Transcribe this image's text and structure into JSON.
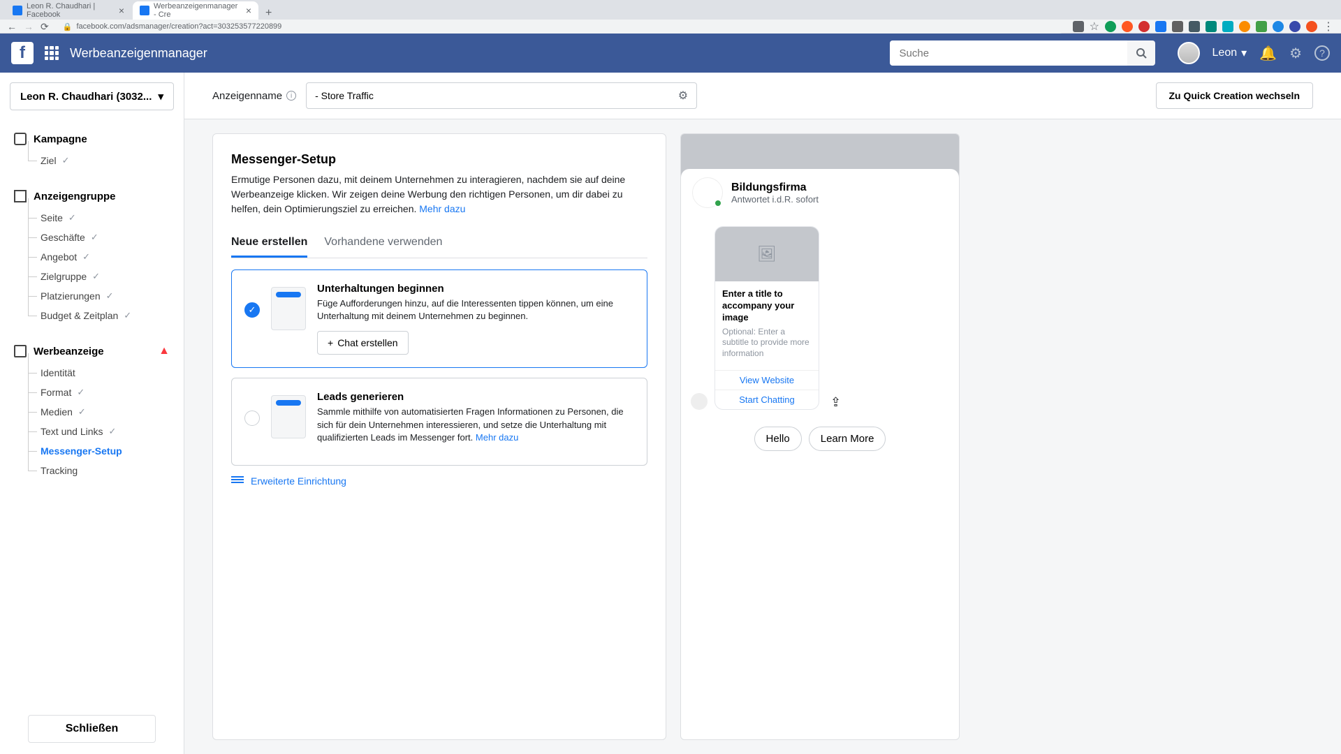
{
  "browser": {
    "tabs": [
      {
        "title": "Leon R. Chaudhari | Facebook"
      },
      {
        "title": "Werbeanzeigenmanager - Cre"
      }
    ],
    "url": "facebook.com/adsmanager/creation?act=303253577220899"
  },
  "header": {
    "app_title": "Werbeanzeigenmanager",
    "search_placeholder": "Suche",
    "user_name": "Leon"
  },
  "sidebar": {
    "account": "Leon R. Chaudhari (3032...",
    "campaign": {
      "label": "Kampagne",
      "items": [
        "Ziel"
      ]
    },
    "adset": {
      "label": "Anzeigengruppe",
      "items": [
        "Seite",
        "Geschäfte",
        "Angebot",
        "Zielgruppe",
        "Platzierungen",
        "Budget & Zeitplan"
      ]
    },
    "ad": {
      "label": "Werbeanzeige",
      "items": [
        "Identität",
        "Format",
        "Medien",
        "Text und Links",
        "Messenger-Setup",
        "Tracking"
      ]
    },
    "close": "Schließen"
  },
  "topbar": {
    "name_label": "Anzeigenname",
    "name_value": "- Store Traffic",
    "quick_btn": "Zu Quick Creation wechseln"
  },
  "card": {
    "title": "Messenger-Setup",
    "desc": "Ermutige Personen dazu, mit deinem Unternehmen zu interagieren, nachdem sie auf deine Werbeanzeige klicken. Wir zeigen deine Werbung den richtigen Personen, um dir dabei zu helfen, dein Optimierungsziel zu erreichen.",
    "more": "Mehr dazu",
    "tabs": [
      "Neue erstellen",
      "Vorhandene verwenden"
    ],
    "opt1": {
      "title": "Unterhaltungen beginnen",
      "desc": "Füge Aufforderungen hinzu, auf die Interessenten tippen können, um eine Unterhaltung mit deinem Unternehmen zu beginnen.",
      "btn": "Chat erstellen"
    },
    "opt2": {
      "title": "Leads generieren",
      "desc": "Sammle mithilfe von automatisierten Fragen Informationen zu Personen, die sich für dein Unternehmen interessieren, und setze die Unterhaltung mit qualifizierten Leads im Messenger fort.",
      "more": "Mehr dazu"
    },
    "advanced": "Erweiterte Einrichtung"
  },
  "preview": {
    "page_name": "Bildungsfirma",
    "status": "Antwortet i.d.R. sofort",
    "msg_title": "Enter a title to accompany your image",
    "msg_sub": "Optional: Enter a subtitle to provide more information",
    "view": "View Website",
    "start": "Start Chatting",
    "qr1": "Hello",
    "qr2": "Learn More"
  }
}
